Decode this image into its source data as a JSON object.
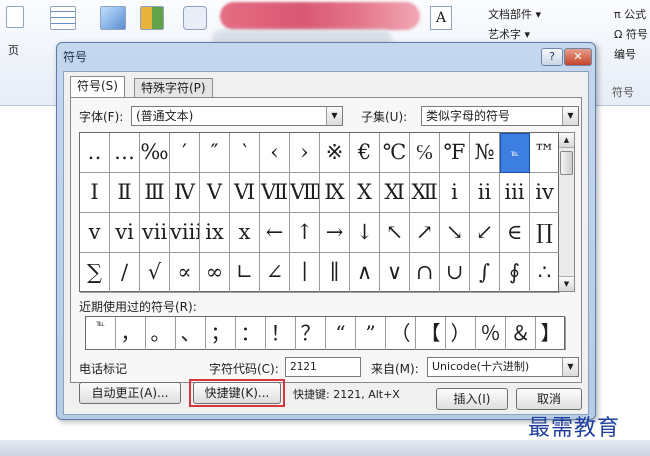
{
  "ribbon": {
    "page_label": "页",
    "textbox_glyph": "A",
    "doc_parts": "文档部件 ▾",
    "wordart": "艺术字 ▾",
    "formula": "π 公式",
    "symbol": "Ω 符号",
    "number": "编号",
    "group_label": "符号"
  },
  "dialog": {
    "title": "符号",
    "help_label": "?",
    "close_label": "✕",
    "tabs": [
      {
        "label": "符号(S)"
      },
      {
        "label": "特殊字符(P)"
      }
    ],
    "font_label": "字体(F):",
    "font_value": "(普通文本)",
    "subset_label": "子集(U):",
    "subset_value": "类似字母的符号",
    "grid": [
      [
        "‥",
        "…",
        "‰",
        "′",
        "″",
        "‵",
        "‹",
        "›",
        "※",
        "€",
        "℃",
        "℅",
        "℉",
        "№",
        "℡",
        "™"
      ],
      [
        "Ⅰ",
        "Ⅱ",
        "Ⅲ",
        "Ⅳ",
        "Ⅴ",
        "Ⅵ",
        "Ⅶ",
        "Ⅷ",
        "Ⅸ",
        "Ⅹ",
        "Ⅺ",
        "Ⅻ",
        "ⅰ",
        "ⅱ",
        "ⅲ",
        "ⅳ"
      ],
      [
        "ⅴ",
        "ⅵ",
        "ⅶ",
        "ⅷ",
        "ⅸ",
        "ⅹ",
        "←",
        "↑",
        "→",
        "↓",
        "↖",
        "↗",
        "↘",
        "↙",
        "∈",
        "∏"
      ],
      [
        "∑",
        "∕",
        "√",
        "∝",
        "∞",
        "∟",
        "∠",
        "∣",
        "∥",
        "∧",
        "∨",
        "∩",
        "∪",
        "∫",
        "∮",
        "∴"
      ]
    ],
    "selected_cell": "0-14",
    "recent_label": "近期使用过的符号(R):",
    "recent": [
      "℡",
      "，",
      "。",
      "、",
      "；",
      "：",
      "！",
      "？",
      "“",
      "”",
      "（",
      "【",
      "）",
      "％",
      "＆",
      "】"
    ],
    "char_name": "电话标记",
    "code_label": "字符代码(C):",
    "code_value": "2121",
    "from_label": "来自(M):",
    "from_value": "Unicode(十六进制)",
    "autocorrect_label": "自动更正(A)...",
    "shortcut_btn_label": "快捷键(K)...",
    "shortcut_text": "快捷键: 2121, Alt+X",
    "insert_label": "插入(I)",
    "cancel_label": "取消"
  },
  "watermark": "最需教育"
}
